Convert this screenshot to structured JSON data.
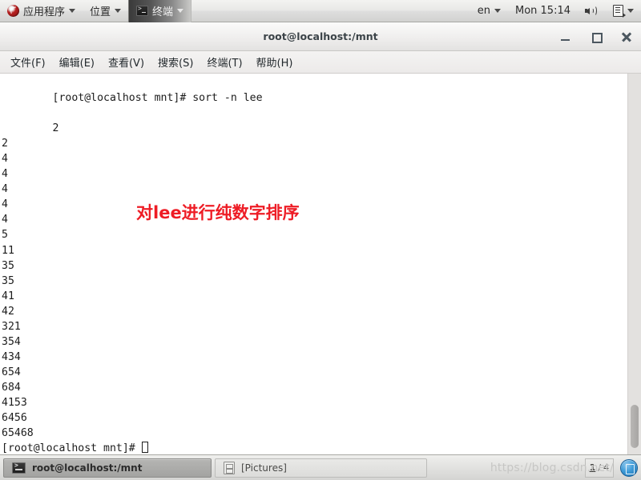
{
  "top_panel": {
    "applications_label": "应用程序",
    "places_label": "位置",
    "active_task_label": "终端",
    "keyboard_layout": "en",
    "clock": "Mon 15:14"
  },
  "window": {
    "title": "root@localhost:/mnt",
    "menu": [
      {
        "label": "文件(F)"
      },
      {
        "label": "编辑(E)"
      },
      {
        "label": "查看(V)"
      },
      {
        "label": "搜索(S)"
      },
      {
        "label": "终端(T)"
      },
      {
        "label": "帮助(H)"
      }
    ],
    "controls": {
      "minimize": "_",
      "maximize": "□",
      "close": "✕"
    }
  },
  "terminal": {
    "command_line": "[root@localhost mnt]# sort -n lee",
    "output_lines": [
      "2",
      "2",
      "4",
      "4",
      "4",
      "4",
      "4",
      "5",
      "11",
      "35",
      "35",
      "41",
      "42",
      "321",
      "354",
      "434",
      "654",
      "684",
      "4153",
      "6456",
      "65468"
    ],
    "final_prompt": "[root@localhost mnt]# ",
    "annotation_text": "对lee进行纯数字排序",
    "annotation_color": "#ee1c25"
  },
  "bottom_panel": {
    "tasks": [
      {
        "label": "root@localhost:/mnt",
        "active": true
      },
      {
        "label": "[Pictures]",
        "active": false
      }
    ],
    "watermark": "https://blog.csdn.net/",
    "workspace_current": "1",
    "workspace_separator": "/",
    "workspace_total": "4"
  }
}
